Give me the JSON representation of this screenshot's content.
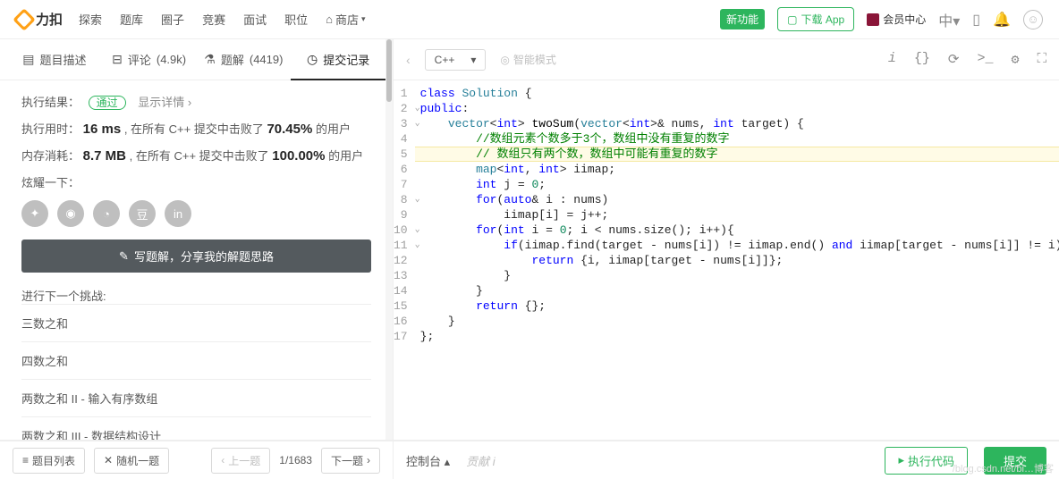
{
  "nav": {
    "brand": "力扣",
    "links": [
      "探索",
      "题库",
      "圈子",
      "竞赛",
      "面试",
      "职位"
    ],
    "shop": "商店",
    "new_badge": "新功能",
    "download": "下载 App",
    "vip": "会员中心",
    "lang_toggle": "中"
  },
  "tabs": {
    "desc": "题目描述",
    "comments_label": "评论",
    "comments_count": "(4.9k)",
    "solutions_label": "题解",
    "solutions_count": "(4419)",
    "submissions": "提交记录"
  },
  "result": {
    "label": "执行结果：",
    "status": "通过",
    "detail": "显示详情 ›",
    "time_label": "执行用时：",
    "time_value": "16 ms",
    "time_text": ", 在所有 C++ 提交中击败了 ",
    "time_pct": "70.45%",
    "time_suffix": " 的用户",
    "mem_label": "内存消耗：",
    "mem_value": "8.7 MB",
    "mem_text": ", 在所有 C++ 提交中击败了 ",
    "mem_pct": "100.00%",
    "mem_suffix": " 的用户",
    "flaunt": "炫耀一下：",
    "write_solution": "写题解，分享我的解题思路",
    "next_label": "进行下一个挑战:",
    "challenges": [
      "三数之和",
      "四数之和",
      "两数之和 II - 输入有序数组",
      "两数之和 III - 数据结构设计"
    ]
  },
  "editor": {
    "language": "C++",
    "smart": "智能模式",
    "lines": [
      "class Solution {",
      "public:",
      "    vector<int> twoSum(vector<int>& nums, int target) {",
      "        //数组元素个数多于3个，数组中没有重复的数字",
      "        // 数组只有两个数，数组中可能有重复的数字",
      "        map<int, int> iimap;",
      "        int j = 0;",
      "        for(auto& i : nums)",
      "            iimap[i] = j++;",
      "        for(int i = 0; i < nums.size(); i++){",
      "            if(iimap.find(target - nums[i]) != iimap.end() and iimap[target - nums[i]] != i){",
      "                return {i, iimap[target - nums[i]]};",
      "            }",
      "        }",
      "        return {};",
      "    }",
      "};"
    ]
  },
  "bottom": {
    "list": "题目列表",
    "random": "随机一题",
    "prev": "上一题",
    "page": "1/1683",
    "next": "下一题",
    "console": "控制台",
    "contrib": "贡献",
    "run": "执行代码",
    "submit": "提交"
  },
  "watermark": "/blog.csdn.net/bi…博客"
}
